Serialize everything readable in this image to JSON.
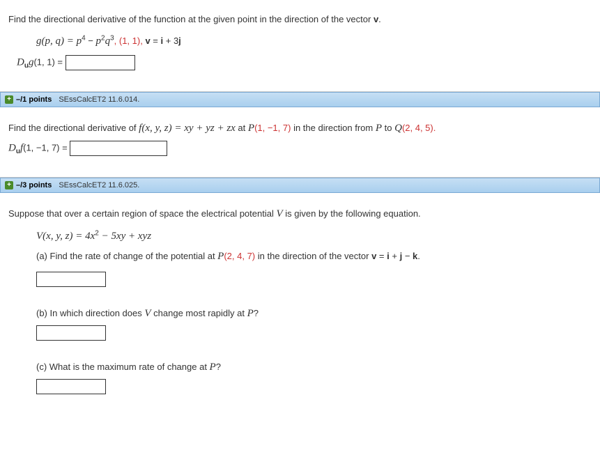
{
  "q1": {
    "prompt_prefix": "Find the directional derivative of the function at the given point in the direction of the vector ",
    "prompt_vec": "v",
    "prompt_suffix": ".",
    "func_lhs": "g(p, q) = p",
    "exp4": "4",
    "minus": " − ",
    "p": "p",
    "exp2": "2",
    "q": "q",
    "exp3": "3",
    "comma_pt": ",    (1, 1),   ",
    "v_eq": "v",
    "eq": " = ",
    "i": "i",
    "plus3": " + 3",
    "j": "j",
    "ans_lhs_D": "D",
    "ans_lhs_u": "u",
    "ans_lhs_g": "g",
    "ans_lhs_pt": "(1, 1) = "
  },
  "q2": {
    "points": "–/1 points",
    "ref": "SEssCalcET2 11.6.014.",
    "prompt_a": "Find the directional derivative of ",
    "f": "f(x, y, z) = xy + yz + zx",
    "prompt_b": " at ",
    "P": "P",
    "pt": "(1, −1, 7)",
    "prompt_c": " in the direction from ",
    "Pa": "P",
    "prompt_d": " to ",
    "Q": "Q",
    "qpt": "(2, 4, 5).",
    "ans_D": "D",
    "ans_u": "u",
    "ans_f": "f",
    "ans_pt": "(1, −1, 7) = "
  },
  "q3": {
    "points": "–/3 points",
    "ref": "SEssCalcET2 11.6.025.",
    "prompt": "Suppose that over a certain region of space the electrical potential ",
    "V": "V",
    "prompt2": " is given by the following equation.",
    "eq_lhs": "V(x, y, z) = 4x",
    "exp2": "2",
    "eq_mid": " − 5xy + xyz",
    "part_a_pre": "(a) Find the rate of change of the potential at ",
    "P": "P",
    "ppt": "(2, 4, 7)",
    "part_a_mid": " in the direction of the vector ",
    "v": "v",
    "veq": " = ",
    "i": "i",
    "plus": " + ",
    "j": "j",
    "minus": " − ",
    "k": "k",
    "dot": ".",
    "part_b_pre": "(b) In which direction does ",
    "Vb": "V",
    "part_b_post": " change most rapidly at ",
    "Pb": "P",
    "qmark": "?",
    "part_c_pre": "(c) What is the maximum rate of change at ",
    "Pc": "P",
    "qmarkc": "?"
  }
}
